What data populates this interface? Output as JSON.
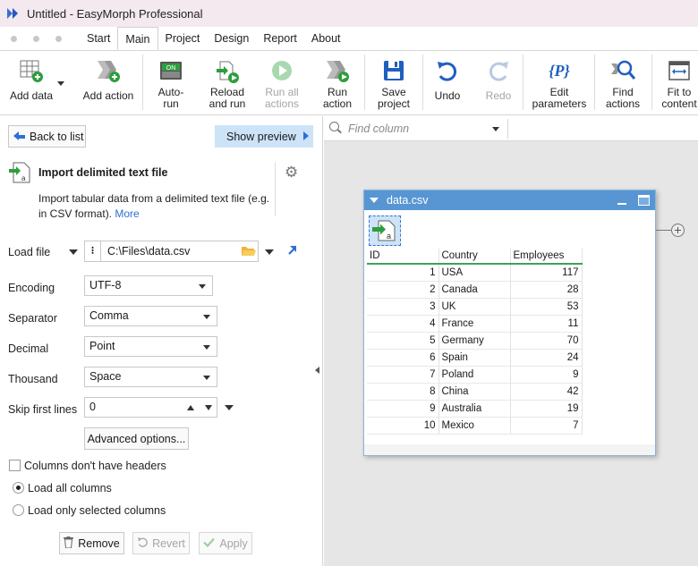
{
  "window": {
    "title": "Untitled - EasyMorph Professional"
  },
  "menu": {
    "tabs": [
      "Start",
      "Main",
      "Project",
      "Design",
      "Report",
      "About"
    ],
    "active": "Main"
  },
  "ribbon": {
    "add_data": "Add data",
    "add_action": "Add action",
    "auto_run_1": "Auto-",
    "auto_run_2": "run",
    "reload_1": "Reload",
    "reload_2": "and run",
    "run_all_1": "Run all",
    "run_all_2": "actions",
    "run_action_1": "Run",
    "run_action_2": "action",
    "save_1": "Save",
    "save_2": "project",
    "undo": "Undo",
    "redo": "Redo",
    "edit_params_1": "Edit",
    "edit_params_2": "parameters",
    "find_actions_1": "Find",
    "find_actions_2": "actions",
    "fit_1": "Fit to",
    "fit_2": "content",
    "on_badge": "ON",
    "param_glyph": "{P}"
  },
  "left": {
    "back": "Back to list",
    "preview": "Show preview",
    "action_title": "Import delimited text file",
    "action_desc": "Import tabular data from a delimited text file (e.g. in CSV format).",
    "more": "More",
    "load_file_label": "Load file",
    "load_file_value": "C:\\Files\\data.csv",
    "encoding_label": "Encoding",
    "encoding_value": "UTF-8",
    "separator_label": "Separator",
    "separator_value": "Comma",
    "decimal_label": "Decimal",
    "decimal_value": "Point",
    "thousand_label": "Thousand",
    "thousand_value": "Space",
    "skip_label": "Skip first lines",
    "skip_value": "0",
    "advanced": "Advanced options...",
    "no_headers": "Columns don't have headers",
    "load_all": "Load all columns",
    "load_selected": "Load only selected columns",
    "remove": "Remove",
    "revert": "Revert",
    "apply": "Apply"
  },
  "find": {
    "placeholder": "Find column"
  },
  "table": {
    "title": "data.csv",
    "columns": [
      "ID",
      "Country",
      "Employees"
    ],
    "rows": [
      [
        "1",
        "USA",
        "117"
      ],
      [
        "2",
        "Canada",
        "28"
      ],
      [
        "3",
        "UK",
        "53"
      ],
      [
        "4",
        "France",
        "11"
      ],
      [
        "5",
        "Germany",
        "70"
      ],
      [
        "6",
        "Spain",
        "24"
      ],
      [
        "7",
        "Poland",
        "9"
      ],
      [
        "8",
        "China",
        "42"
      ],
      [
        "9",
        "Australia",
        "19"
      ],
      [
        "10",
        "Mexico",
        "7"
      ]
    ]
  },
  "colors": {
    "accent": "#2d6fd6",
    "header_blue": "#5796d3",
    "green": "#3aa25a"
  }
}
